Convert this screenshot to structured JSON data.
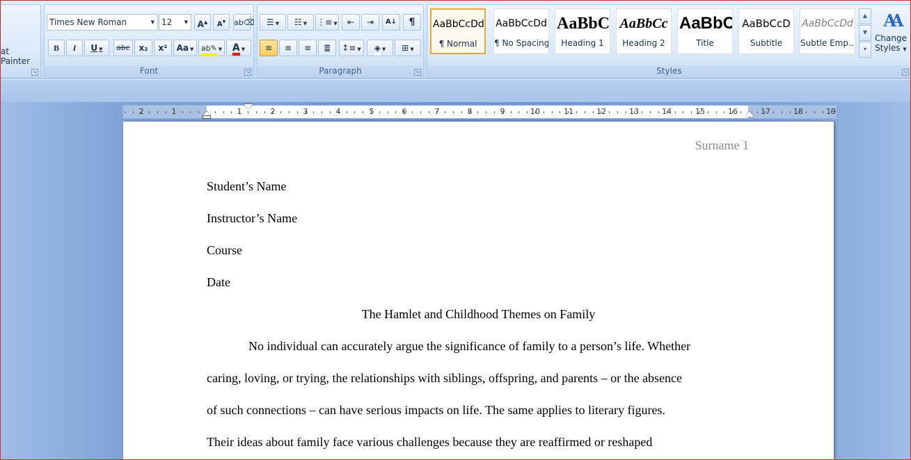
{
  "clipboard": {
    "format_painter_label": "at Painter"
  },
  "font": {
    "group_label": "Font",
    "font_name": "Times New Roman",
    "font_size": "12",
    "grow_icon": "A",
    "shrink_icon": "A",
    "bold": "B",
    "italic": "I",
    "underline": "U",
    "strikethrough": "abc",
    "subscript": "x₂",
    "superscript": "x²",
    "change_case": "Aa",
    "highlight_label": "ab",
    "font_color_label": "A"
  },
  "paragraph": {
    "group_label": "Paragraph",
    "sort_label": "A↓",
    "pilcrow": "¶"
  },
  "styles": {
    "group_label": "Styles",
    "tiles": [
      {
        "sample": "AaBbCcDd",
        "name": "¶ Normal"
      },
      {
        "sample": "AaBbCcDd",
        "name": "¶ No Spacing"
      },
      {
        "sample": "AaBbC",
        "name": "Heading 1"
      },
      {
        "sample": "AaBbCc",
        "name": "Heading 2"
      },
      {
        "sample": "AaBbC",
        "name": "Title"
      },
      {
        "sample": "AaBbCcD",
        "name": "Subtitle"
      },
      {
        "sample": "AaBbCcDd",
        "name": "Subtle Emp..."
      }
    ],
    "change_styles_line1": "Change",
    "change_styles_line2": "Styles",
    "change_styles_icon": "AA"
  },
  "ruler": {
    "left_labels": [
      "2",
      "1"
    ],
    "labels": [
      "1",
      "2",
      "3",
      "4",
      "5",
      "6",
      "7",
      "8",
      "9",
      "10",
      "11",
      "12",
      "13",
      "14",
      "15",
      "16",
      "17",
      "18",
      "19"
    ]
  },
  "document": {
    "header": "Surname 1",
    "lines": [
      "Student’s Name",
      "Instructor’s Name",
      "Course",
      "Date"
    ],
    "title": "The Hamlet and Childhood Themes on Family",
    "body": [
      "No individual can accurately argue the significance of family to a person’s life. Whether",
      "caring, loving, or trying, the relationships with siblings, offspring, and parents – or the absence",
      "of such connections – can have serious impacts on life. The same applies to literary figures.",
      "Their ideas about family face various challenges because they are reaffirmed or reshaped"
    ]
  }
}
